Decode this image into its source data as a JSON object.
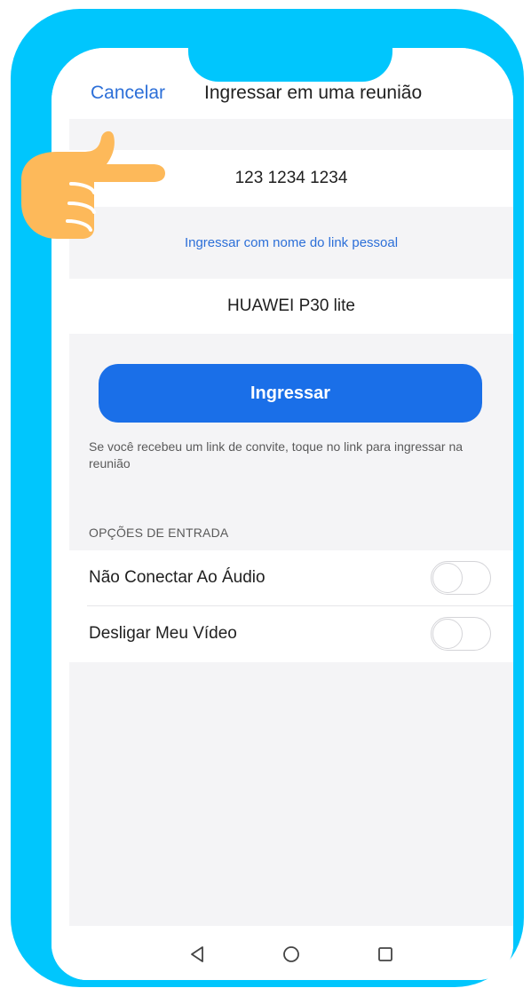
{
  "header": {
    "cancel_label": "Cancelar",
    "title": "Ingressar em uma reunião"
  },
  "meeting_id_field": {
    "value": "123 1234 1234"
  },
  "personal_link_label": "Ingressar com nome do link pessoal",
  "name_field": {
    "value": "HUAWEI P30 lite"
  },
  "join_button_label": "Ingressar",
  "hint_text": "Se você recebeu um link de convite, toque no link para ingressar na reunião",
  "options": {
    "section_title": "OPÇÕES DE ENTRADA",
    "items": [
      {
        "label": "Não Conectar Ao Áudio",
        "enabled": false
      },
      {
        "label": "Desligar Meu Vídeo",
        "enabled": false
      }
    ]
  },
  "navbar": {
    "icons": [
      "back-icon",
      "home-icon",
      "recents-icon"
    ]
  },
  "colors": {
    "frame": "#00c6fd",
    "accent_blue": "#1a6fe8",
    "link_blue": "#2c6fd8",
    "hand": "#fdb95a",
    "background_gray": "#f4f4f6"
  }
}
